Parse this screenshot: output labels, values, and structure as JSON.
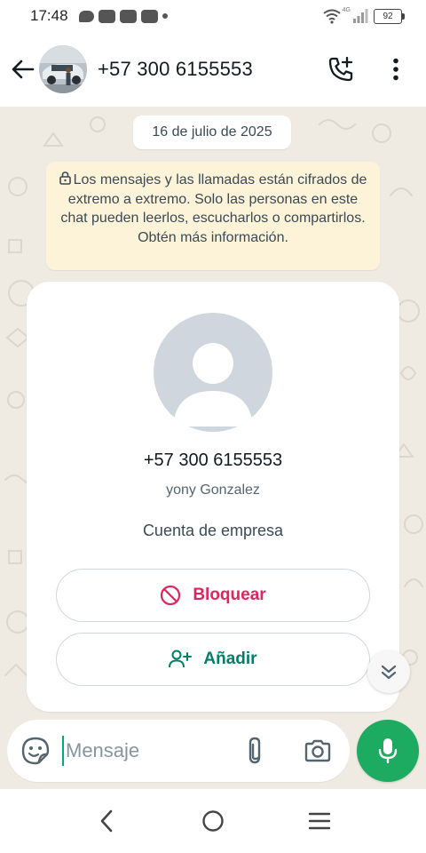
{
  "status_bar": {
    "time": "17:48",
    "network": "4G",
    "battery": "92",
    "icons": [
      "chat-notification-icon",
      "app-notification-icon",
      "app-notification-icon",
      "app-notification-icon",
      "more-notifications-dot",
      "wifi-icon",
      "signal-icon",
      "battery-icon"
    ]
  },
  "header": {
    "title": "+57 300 6155553",
    "icons": [
      "back-arrow-icon",
      "add-call-icon",
      "more-vert-icon"
    ]
  },
  "chat": {
    "date_chip": "16 de julio de 2025",
    "encryption_notice": "Los mensajes y las llamadas están cifrados de extremo a extremo. Solo las personas en este chat pueden leerlos, escucharlos o compartirlos. Obtén más información."
  },
  "contact_card": {
    "phone": "+57 300 6155553",
    "name": "yony Gonzalez",
    "account_type": "Cuenta de empresa",
    "block_label": "Bloquear",
    "add_label": "Añadir"
  },
  "composer": {
    "placeholder": "Mensaje",
    "value": ""
  },
  "colors": {
    "accent_green": "#1daa61",
    "block_red": "#e0245e",
    "add_green": "#008069",
    "chat_background": "#efeae2",
    "notice_background": "#fdf3d8"
  }
}
